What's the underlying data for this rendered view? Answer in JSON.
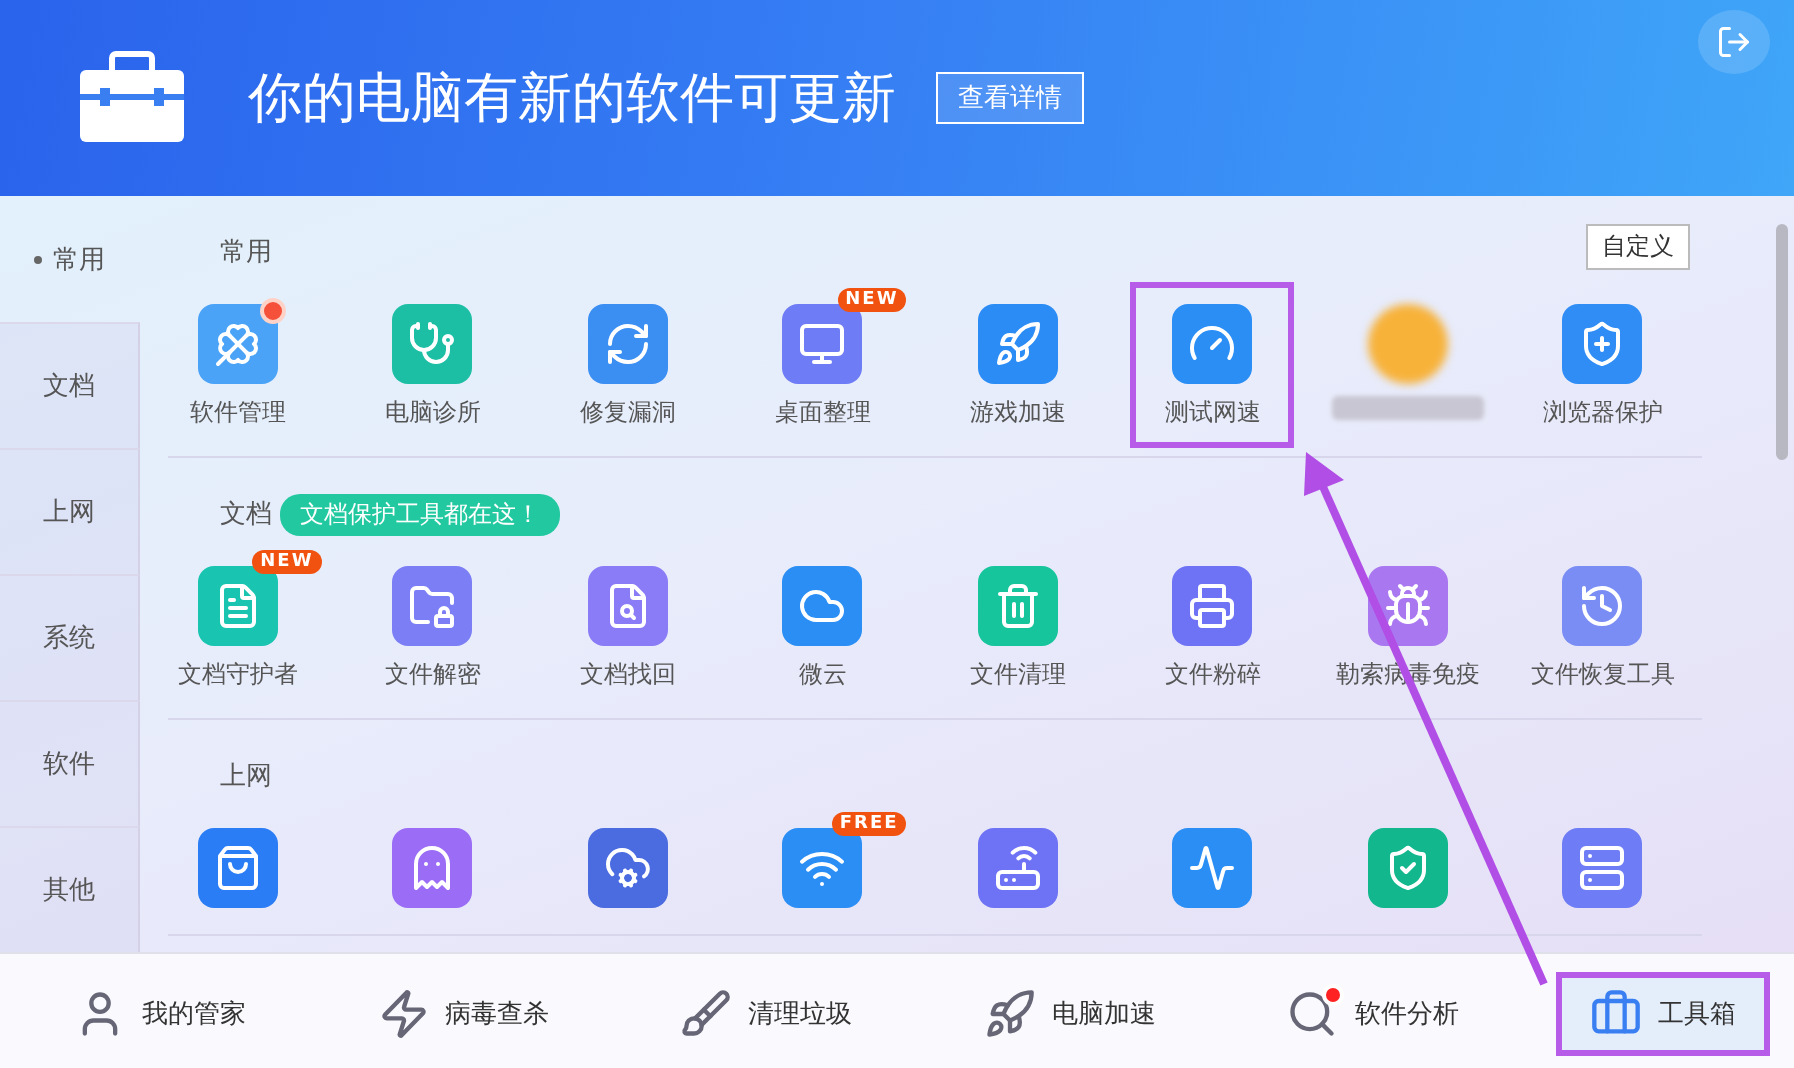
{
  "header": {
    "title": "你的电脑有新的软件可更新",
    "details_button": "查看详情"
  },
  "sidebar": [
    {
      "label": "常用",
      "selected": true
    },
    {
      "label": "文档",
      "selected": false
    },
    {
      "label": "上网",
      "selected": false
    },
    {
      "label": "系统",
      "selected": false
    },
    {
      "label": "软件",
      "selected": false
    },
    {
      "label": "其他",
      "selected": false
    }
  ],
  "customize_button": "自定义",
  "sections": [
    {
      "title": "常用",
      "tools": [
        {
          "kind": "tool",
          "label": "软件管理",
          "dot": true,
          "highlighted": false
        },
        {
          "kind": "tool",
          "label": "电脑诊所",
          "highlighted": false
        },
        {
          "kind": "tool",
          "label": "修复漏洞",
          "highlighted": false
        },
        {
          "kind": "tool",
          "label": "桌面整理",
          "badge": "NEW",
          "highlighted": false
        },
        {
          "kind": "tool",
          "label": "游戏加速",
          "highlighted": false
        },
        {
          "kind": "tool",
          "label": "测试网速",
          "highlighted": true
        },
        {
          "kind": "blurred",
          "highlighted": false
        },
        {
          "kind": "tool",
          "label": "浏览器保护",
          "highlighted": false
        }
      ]
    },
    {
      "title": "文档",
      "tip": "文档保护工具都在这！",
      "tools": [
        {
          "kind": "tool",
          "label": "文档守护者",
          "badge": "NEW",
          "highlighted": false
        },
        {
          "kind": "tool",
          "label": "文件解密",
          "highlighted": false
        },
        {
          "kind": "tool",
          "label": "文档找回",
          "highlighted": false
        },
        {
          "kind": "tool",
          "label": "微云",
          "highlighted": false
        },
        {
          "kind": "tool",
          "label": "文件清理",
          "highlighted": false
        },
        {
          "kind": "tool",
          "label": "文件粉碎",
          "highlighted": false
        },
        {
          "kind": "tool",
          "label": "勒索病毒免疫",
          "highlighted": false
        },
        {
          "kind": "tool",
          "label": "文件恢复工具",
          "highlighted": false
        }
      ]
    },
    {
      "title": "上网",
      "tools": [
        {
          "kind": "cut",
          "highlighted": false
        },
        {
          "kind": "cut",
          "highlighted": false
        },
        {
          "kind": "cut",
          "highlighted": false
        },
        {
          "kind": "cut",
          "badge": "FREE",
          "highlighted": false
        },
        {
          "kind": "cut",
          "highlighted": false
        },
        {
          "kind": "cut",
          "highlighted": false
        },
        {
          "kind": "cut",
          "highlighted": false
        },
        {
          "kind": "cut",
          "highlighted": false
        }
      ]
    }
  ],
  "bottom_nav": [
    {
      "label": "我的管家",
      "selected": false,
      "dot": false,
      "highlighted": false
    },
    {
      "label": "病毒查杀",
      "selected": false,
      "dot": false,
      "highlighted": false
    },
    {
      "label": "清理垃圾",
      "selected": false,
      "dot": false,
      "highlighted": false
    },
    {
      "label": "电脑加速",
      "selected": false,
      "dot": false,
      "highlighted": false
    },
    {
      "label": "软件分析",
      "selected": false,
      "dot": true,
      "highlighted": false
    },
    {
      "label": "工具箱",
      "selected": true,
      "dot": false,
      "highlighted": true
    }
  ]
}
